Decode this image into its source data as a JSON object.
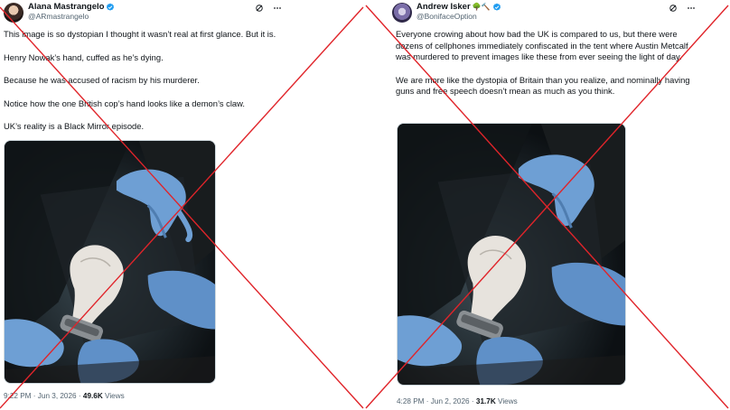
{
  "posts": [
    {
      "display_name": "Alana Mastrangelo",
      "handle": "@ARmastrangelo",
      "paragraphs": [
        "This image is so dystopian I thought it wasn’t real at first glance. But it is.",
        "Henry Nowak’s hand, cuffed as he’s dying.",
        "Because he was accused of racism by his murderer.",
        "Notice how the one British cop’s hand looks like a demon’s claw.",
        "UK’s reality is a Black Mirror episode."
      ],
      "time": "9:22 PM",
      "date": "Jun 3, 2026",
      "views_count": "49.6K",
      "views_label": "Views"
    },
    {
      "display_name": "Andrew Isker",
      "handle": "@BonifaceOption",
      "name_emojis": "🌳🔨",
      "paragraphs": [
        "Everyone crowing about how bad the UK is compared to us, but there were dozens of cellphones immediately confiscated in the tent where Austin Metcalf was murdered to prevent images like these from ever seeing the light of day.",
        "We are more like the dystopia of Britain than you realize, and nominally having guns and free speech doesn’t mean as much as you think."
      ],
      "time": "4:28 PM",
      "date": "Jun 2, 2026",
      "views_count": "31.7K",
      "views_label": "Views"
    }
  ],
  "separator": "·",
  "colors": {
    "verified": "#1d9bf0",
    "cross": "#e0242a",
    "muted": "#536471",
    "glove": "#6e9fd4"
  },
  "icons": [
    "verified-badge-icon",
    "grok-icon",
    "more-icon"
  ]
}
